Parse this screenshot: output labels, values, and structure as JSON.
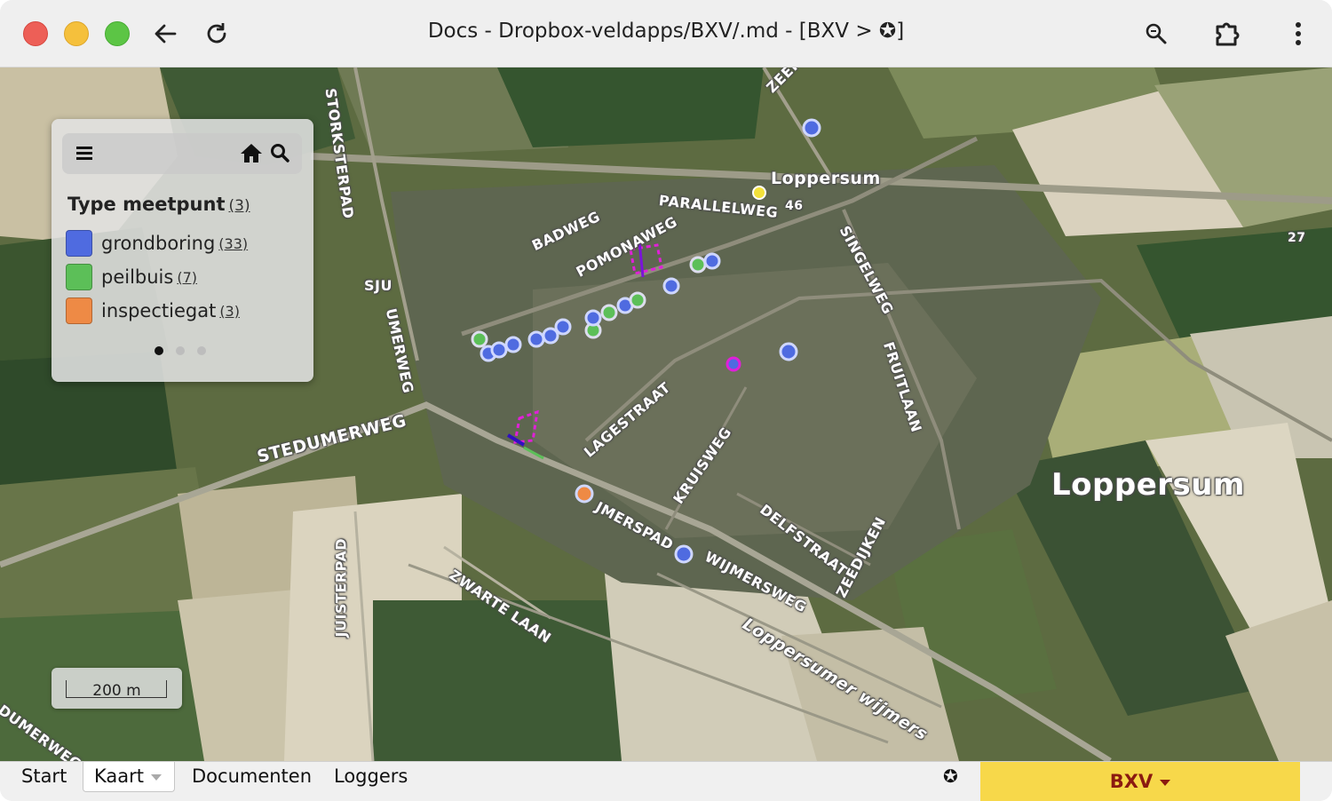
{
  "window": {
    "title": "Docs - Dropbox-veldapps/BXV/.md - [BXV > ✪]"
  },
  "toolbar_icons": [
    "back-arrow-icon",
    "reload-icon",
    "zoom-icon",
    "extension-icon",
    "more-vertical-icon"
  ],
  "map": {
    "street_labels": {
      "storksterpad": "STORKSTERPAD",
      "zeerijp": "ZEERIJ",
      "loppersum_station": "Loppersum",
      "parallelweg": "PARALLELWEG",
      "badweg": "BADWEG",
      "pomonaweg": "POMONAWEG",
      "sjumerweg": "SJU",
      "sjumerweg2": "UMERWEG",
      "singelweg": "SINGELWEG",
      "fruitlaan": "FRUITLAAN",
      "lagestraat": "LAGESTRAAT",
      "stedumerweg": "STEDUMERWEG",
      "kruisweg": "KRUISWEG",
      "delfstraat": "DELFSTRAAT",
      "wijmerspad": "JMERSPAD",
      "wijmersweg": "WIJMERSWEG",
      "zeedijken": "ZEEDIJKEN",
      "zwartelaan": "ZWARTE LAAN",
      "juisterpad": "JUISTERPAD",
      "loppersumer_wijmers": "Loppersumer wijmers",
      "dumerweg": "DUMERWEG",
      "n46": "46",
      "n27": "27",
      "town": "Loppersum"
    }
  },
  "legend": {
    "title": "Type meetpunt",
    "title_count": "(3)",
    "items": [
      {
        "name": "grondboring",
        "count": "(33)",
        "color": "#4f6be0"
      },
      {
        "name": "peilbuis",
        "count": "(7)",
        "color": "#5cbf58"
      },
      {
        "name": "inspectiegat",
        "count": "(3)",
        "color": "#ee8a45"
      }
    ],
    "icons": [
      "menu-icon",
      "home-icon",
      "search-icon"
    ],
    "pages": 3,
    "active_page": 0
  },
  "scale": {
    "label": "200 m"
  },
  "bottombar": {
    "start": "Start",
    "kaart": "Kaart",
    "documenten": "Documenten",
    "loggers": "Loggers",
    "star_icon": "✪",
    "project": "BXV"
  },
  "colors": {
    "project_bg": "#f7d84a",
    "project_text": "#8b1a10",
    "marker_blue": "#4f6be0",
    "marker_magenta": "#e020d8"
  }
}
